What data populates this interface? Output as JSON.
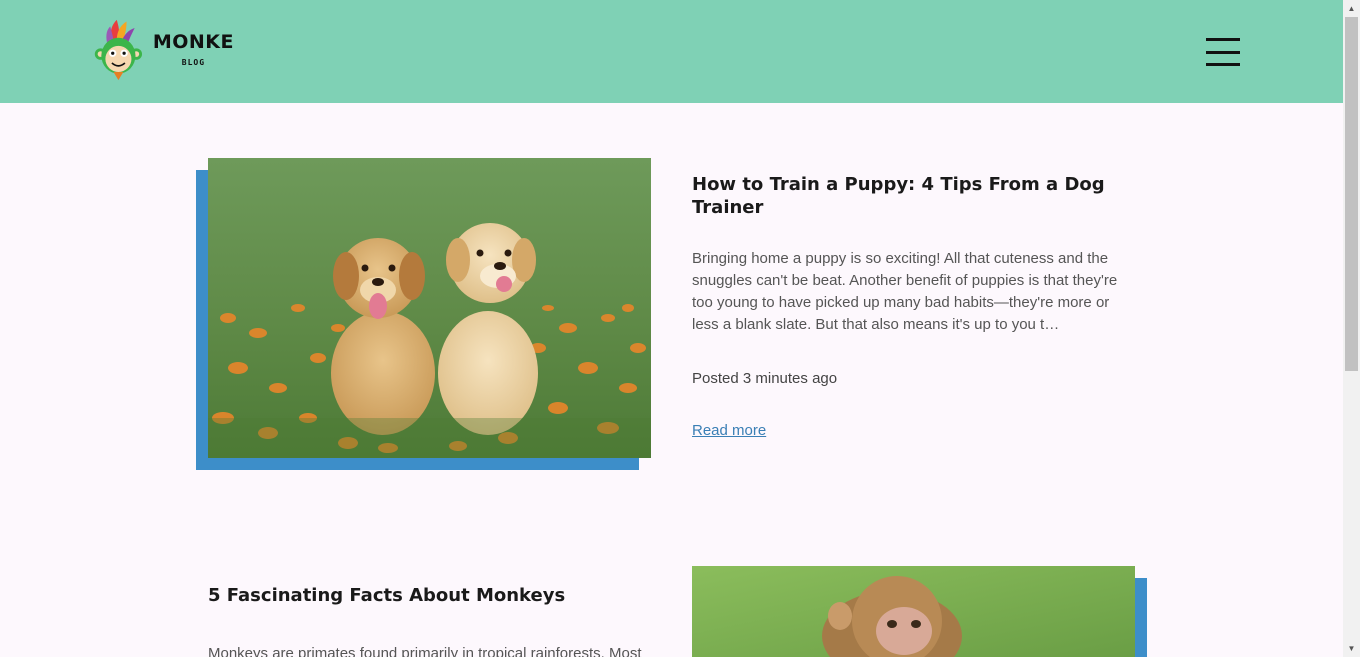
{
  "header": {
    "logo_title": "MONKE",
    "logo_subtitle": "BLOG",
    "background_color": "#7fd1b5"
  },
  "posts": [
    {
      "title": "How to Train a Puppy: 4 Tips From a Dog Trainer",
      "excerpt": "Bringing home a puppy is so exciting! All that cuteness and the snuggles can't be beat. Another benefit of puppies is that they're too young to have picked up many bad habits—they're more or less a blank slate. But that also means it's up to you t…",
      "posted": "Posted 3 minutes ago",
      "read_more": "Read more",
      "image": "puppies-image"
    },
    {
      "title": "5 Fascinating Facts About Monkeys",
      "excerpt": "Monkeys are primates found primarily in tropical rainforests. Most",
      "image": "monkey-image"
    }
  ],
  "colors": {
    "accent": "#3d8ec9",
    "link": "#3a7fb5",
    "page_bg": "#fdf8fd"
  }
}
